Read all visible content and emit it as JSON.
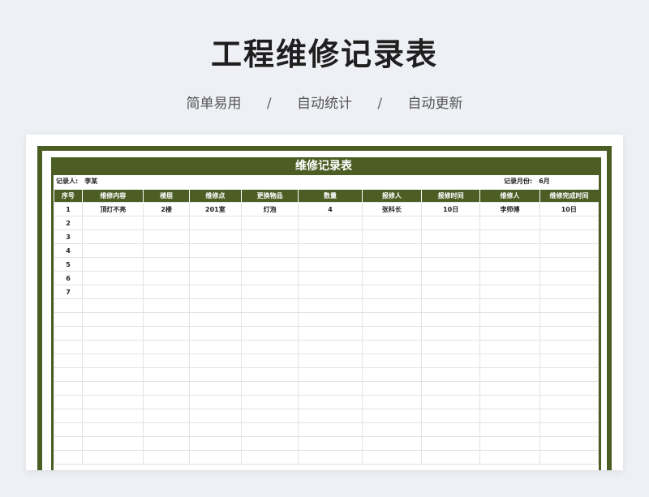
{
  "header": {
    "title": "工程维修记录表",
    "tagline": [
      "简单易用",
      "自动统计",
      "自动更新"
    ],
    "separator": "/"
  },
  "sheet": {
    "title": "维修记录表",
    "recorder_label": "记录人:",
    "recorder_value": "李某",
    "month_label": "记录月份:",
    "month_value": "6月"
  },
  "table": {
    "columns": [
      "序号",
      "维修内容",
      "楼层",
      "维修点",
      "更换物品",
      "数量",
      "报修人",
      "报修时间",
      "维修人",
      "维修完成时间"
    ],
    "rows": [
      [
        "1",
        "顶灯不亮",
        "2楼",
        "201室",
        "灯泡",
        "4",
        "张科长",
        "10日",
        "李师傅",
        "10日"
      ],
      [
        "2",
        "",
        "",
        "",
        "",
        "",
        "",
        "",
        "",
        ""
      ],
      [
        "3",
        "",
        "",
        "",
        "",
        "",
        "",
        "",
        "",
        ""
      ],
      [
        "4",
        "",
        "",
        "",
        "",
        "",
        "",
        "",
        "",
        ""
      ],
      [
        "5",
        "",
        "",
        "",
        "",
        "",
        "",
        "",
        "",
        ""
      ],
      [
        "6",
        "",
        "",
        "",
        "",
        "",
        "",
        "",
        "",
        ""
      ],
      [
        "7",
        "",
        "",
        "",
        "",
        "",
        "",
        "",
        "",
        ""
      ],
      [
        "",
        "",
        "",
        "",
        "",
        "",
        "",
        "",
        "",
        ""
      ],
      [
        "",
        "",
        "",
        "",
        "",
        "",
        "",
        "",
        "",
        ""
      ],
      [
        "",
        "",
        "",
        "",
        "",
        "",
        "",
        "",
        "",
        ""
      ],
      [
        "",
        "",
        "",
        "",
        "",
        "",
        "",
        "",
        "",
        ""
      ],
      [
        "",
        "",
        "",
        "",
        "",
        "",
        "",
        "",
        "",
        ""
      ],
      [
        "",
        "",
        "",
        "",
        "",
        "",
        "",
        "",
        "",
        ""
      ],
      [
        "",
        "",
        "",
        "",
        "",
        "",
        "",
        "",
        "",
        ""
      ],
      [
        "",
        "",
        "",
        "",
        "",
        "",
        "",
        "",
        "",
        ""
      ],
      [
        "",
        "",
        "",
        "",
        "",
        "",
        "",
        "",
        "",
        ""
      ],
      [
        "",
        "",
        "",
        "",
        "",
        "",
        "",
        "",
        "",
        ""
      ],
      [
        "",
        "",
        "",
        "",
        "",
        "",
        "",
        "",
        "",
        ""
      ],
      [
        "",
        "",
        "",
        "",
        "",
        "",
        "",
        "",
        "",
        ""
      ]
    ]
  },
  "colors": {
    "accent": "#4d5e25",
    "background": "#eef0f5"
  }
}
